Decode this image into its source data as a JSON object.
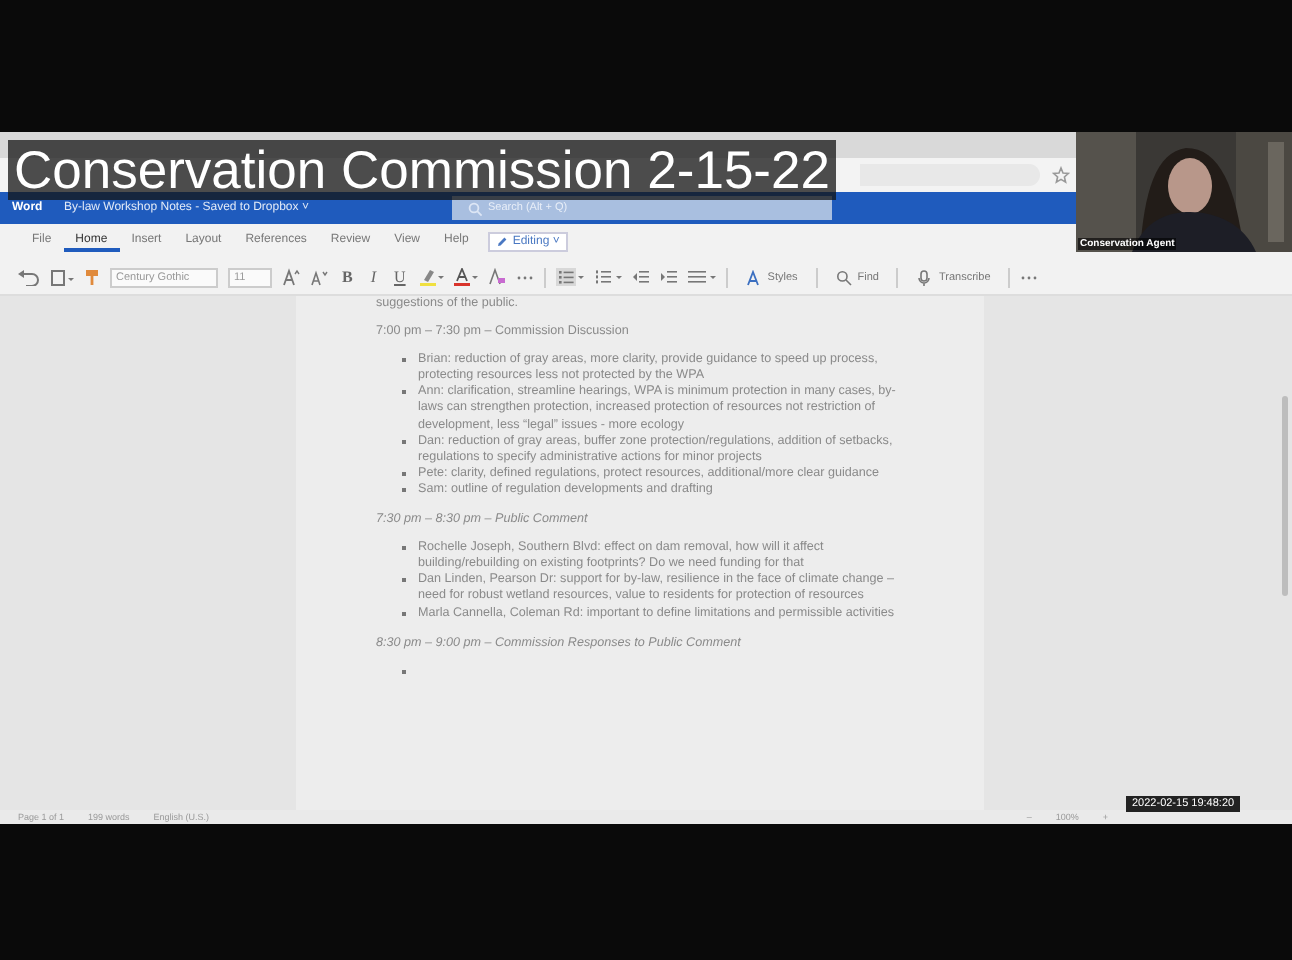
{
  "caption": "Conservation Commission 2-15-22",
  "webcam": {
    "name": "Conservation Agent"
  },
  "timestamp": "2022-02-15 19:48:20",
  "app_bar": {
    "app": "Word",
    "document": "By-law Workshop Notes - Saved to Dropbox ˅",
    "search": {
      "placeholder": "Search (Alt + Q)"
    }
  },
  "ribbon_tabs": [
    {
      "label": "File",
      "selected": false
    },
    {
      "label": "Home",
      "selected": true
    },
    {
      "label": "Insert",
      "selected": false
    },
    {
      "label": "Layout",
      "selected": false
    },
    {
      "label": "References",
      "selected": false
    },
    {
      "label": "Review",
      "selected": false
    },
    {
      "label": "View",
      "selected": false
    },
    {
      "label": "Help",
      "selected": false
    }
  ],
  "mode_button": "Editing ˅",
  "toolbar": {
    "font": "Century Gothic",
    "size": "11",
    "bold": "B",
    "italic": "I",
    "underline": "U",
    "styles": "Styles",
    "find": "Find",
    "transcribe": "Transcribe"
  },
  "document": [
    {
      "kind": "para",
      "text": "suggestions of the public."
    },
    {
      "kind": "heading",
      "text": "7:00 pm – 7:30 pm – Commission Discussion",
      "italic": false
    },
    {
      "kind": "list",
      "items": [
        "Brian: reduction of gray areas, more clarity, provide guidance to speed up process, protecting resources less not protected by the WPA",
        "Ann: clarification, streamline hearings, WPA is minimum protection in many cases, by-laws can strengthen protection, increased protection of resources not restriction of development, less “legal” issues - more ecology",
        "Dan: reduction of gray areas, buffer zone protection/regulations, addition of setbacks, regulations to specify administrative actions for minor projects",
        "Pete: clarity, defined regulations, protect resources, additional/more clear guidance",
        "Sam: outline of regulation developments and drafting"
      ]
    },
    {
      "kind": "heading",
      "text": "7:30 pm – 8:30 pm – Public Comment",
      "italic": true
    },
    {
      "kind": "list",
      "items": [
        "Rochelle Joseph, Southern Blvd: effect on dam removal, how will it affect building/rebuilding on existing footprints? Do we need funding for that",
        "Dan Linden, Pearson Dr: support for by-law, resilience in the face of climate change – need for robust wetland resources, value to residents for protection of resources",
        "Marla Cannella, Coleman Rd: important to define limitations and permissible activities"
      ]
    },
    {
      "kind": "heading",
      "text": "8:30 pm – 9:00 pm – Commission Responses to Public Comment",
      "italic": true
    },
    {
      "kind": "empty_bullet"
    }
  ],
  "status_bar": {
    "page": "Page 1 of 1",
    "words": "199 words",
    "language": "English (U.S.)",
    "zoom_out": "–",
    "zoom": "100%",
    "zoom_in": "+"
  }
}
